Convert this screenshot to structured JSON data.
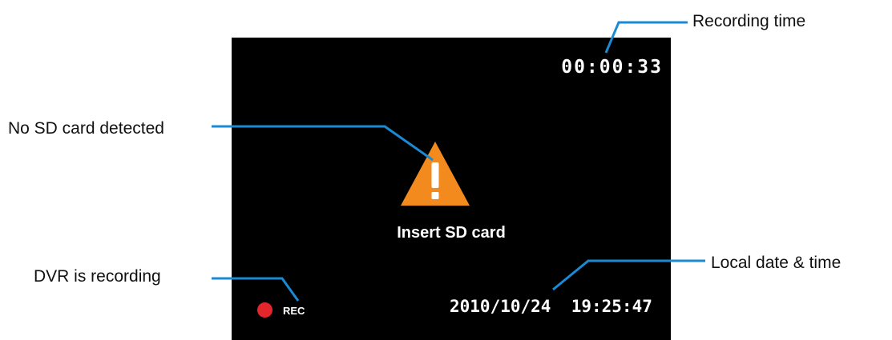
{
  "callouts": {
    "recording_time": "Recording time",
    "no_sd_card": "No SD card detected",
    "dvr_recording": "DVR is recording",
    "local_datetime": "Local date & time"
  },
  "screen": {
    "recording_time": "00:00:33",
    "message": "Insert SD card",
    "rec_label": "REC",
    "datetime": "2010/10/24  19:25:47"
  },
  "icons": {
    "warning": "warning-triangle-icon",
    "recording": "record-dot-icon"
  },
  "colors": {
    "screen_bg": "#000000",
    "leader_line": "#1a8ad4",
    "warning": "#f28a1e",
    "rec_dot": "#e3262b",
    "osd_text": "#ffffff"
  }
}
